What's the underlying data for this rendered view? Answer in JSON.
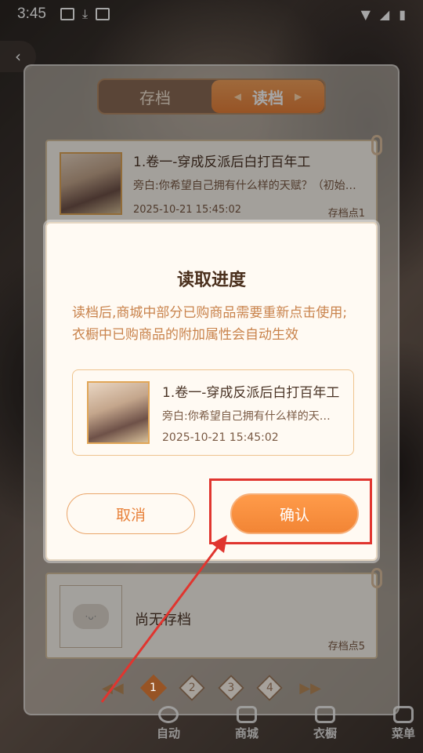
{
  "status_bar": {
    "time": "3:45"
  },
  "tabs": {
    "save": "存档",
    "load": "读档"
  },
  "slot1": {
    "title": "1.卷一-穿成反派后白打百年工",
    "desc": "旁白:你希望自己拥有什么样的天赋？（初始…",
    "date": "2025-10-21 15:45:02",
    "slot_label": "存档点1"
  },
  "slot5": {
    "empty_label": "尚无存档",
    "slot_label": "存档点5"
  },
  "pager": {
    "pages": [
      "1",
      "2",
      "3",
      "4"
    ],
    "current": "1"
  },
  "bottom_nav": {
    "auto": "自动",
    "shop": "商城",
    "wardrobe": "衣橱",
    "menu": "菜单"
  },
  "dialog": {
    "title": "读取进度",
    "message": "读档后,商城中部分已购商品需要重新点击使用;衣橱中已购商品的附加属性会自动生效",
    "card": {
      "title": "1.卷一-穿成反派后白打百年工",
      "desc": "旁白:你希望自己拥有什么样的天…",
      "date": "2025-10-21 15:45:02"
    },
    "cancel": "取消",
    "confirm": "确认"
  },
  "colors": {
    "accent": "#e8813a",
    "annotation": "#e0352f"
  }
}
